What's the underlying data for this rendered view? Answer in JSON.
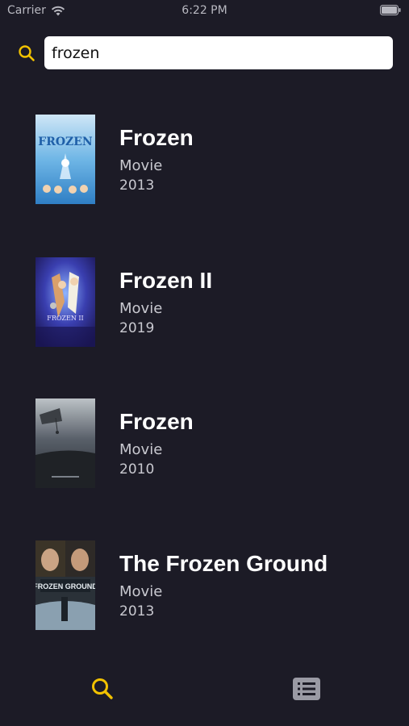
{
  "status_bar": {
    "carrier": "Carrier",
    "time": "6:22 PM"
  },
  "search": {
    "value": "frozen",
    "icon": "search-icon"
  },
  "results": [
    {
      "title": "Frozen",
      "type": "Movie",
      "year": "2013"
    },
    {
      "title": "Frozen II",
      "type": "Movie",
      "year": "2019"
    },
    {
      "title": "Frozen",
      "type": "Movie",
      "year": "2010"
    },
    {
      "title": "The Frozen Ground",
      "type": "Movie",
      "year": "2013"
    }
  ],
  "tab_bar": {
    "tabs": [
      {
        "icon": "search-icon",
        "active": true
      },
      {
        "icon": "list-icon",
        "active": false
      }
    ]
  },
  "colors": {
    "background": "#1c1b26",
    "accent": "#f2c200",
    "text_primary": "#ffffff",
    "text_secondary": "#c9c9d0",
    "inactive_icon": "#9a9aa4"
  }
}
